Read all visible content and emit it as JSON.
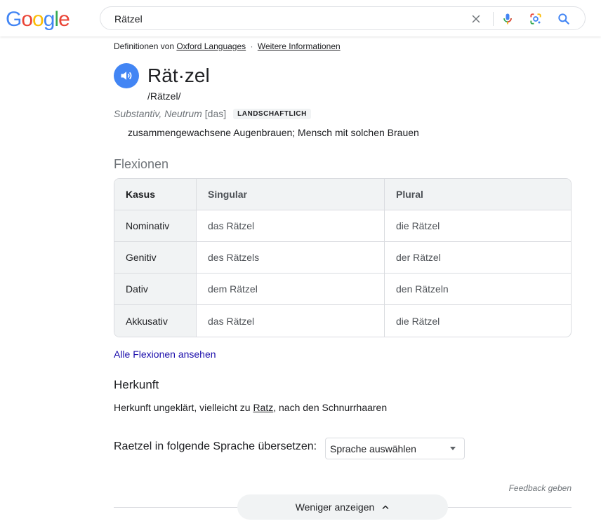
{
  "header": {
    "logo_letters": [
      {
        "char": "G",
        "color": "#4285f4"
      },
      {
        "char": "o",
        "color": "#ea4335"
      },
      {
        "char": "o",
        "color": "#fbbc05"
      },
      {
        "char": "g",
        "color": "#4285f4"
      },
      {
        "char": "l",
        "color": "#34a853"
      },
      {
        "char": "e",
        "color": "#ea4335"
      }
    ],
    "search": {
      "value": "Rätzel",
      "icons": [
        "close-icon",
        "microphone-icon",
        "lens-icon",
        "search-icon"
      ]
    }
  },
  "dictionary": {
    "source_prefix": "Definitionen von",
    "source_name": "Oxford Languages",
    "source_separator": "·",
    "more_info": "Weitere Informationen",
    "headword": "Rät·zel",
    "phonetic": "/Rätzel/",
    "pos": "Substantiv, Neutrum",
    "gender": "[das]",
    "tag": "LANDSCHAFTLICH",
    "definition": "zusammengewachsene Augenbrauen; Mensch mit solchen Brauen",
    "inflections_title": "Flexionen",
    "table": {
      "headers": [
        "Kasus",
        "Singular",
        "Plural"
      ],
      "rows": [
        [
          "Nominativ",
          "das Rätzel",
          "die Rätzel"
        ],
        [
          "Genitiv",
          "des Rätzels",
          "der Rätzel"
        ],
        [
          "Dativ",
          "dem Rätzel",
          "den Rätzeln"
        ],
        [
          "Akkusativ",
          "das Rätzel",
          "die Rätzel"
        ]
      ]
    },
    "all_inflections_link": "Alle Flexionen ansehen",
    "origin_title": "Herkunft",
    "origin_prefix": "Herkunft ungeklärt, vielleicht zu ",
    "origin_link": "Ratz",
    "origin_suffix": ", nach den Schnurrhaaren",
    "translate_label": "Raetzel in folgende Sprache übersetzen:",
    "translate_select": "Sprache auswählen",
    "feedback": "Feedback geben",
    "show_less": "Weniger anzeigen"
  },
  "colors": {
    "accent_blue": "#4285f4",
    "link": "#1a0dab",
    "muted": "#70757a"
  }
}
